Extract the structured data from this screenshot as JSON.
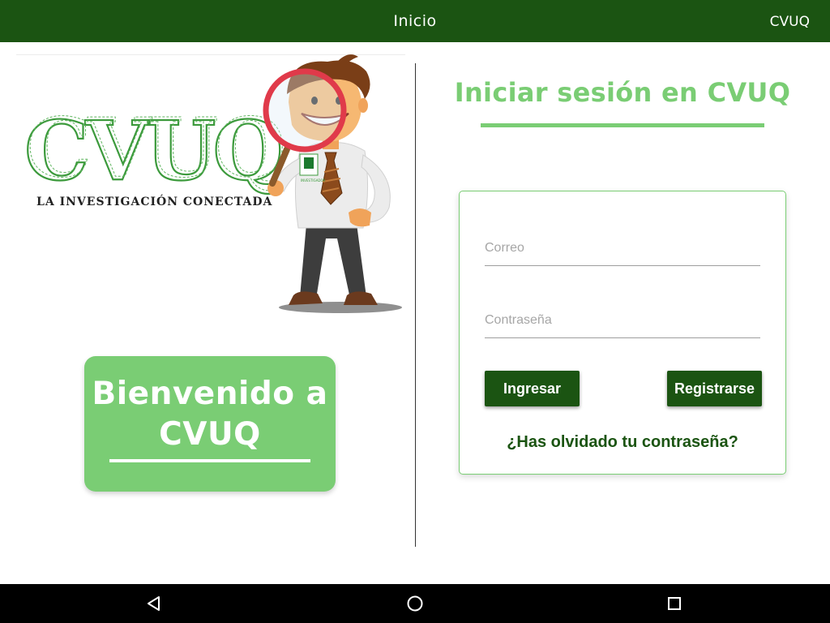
{
  "app_bar": {
    "title": "Inicio",
    "action_label": "CVUQ",
    "color": "#1b5412"
  },
  "logo": {
    "wordmark": "CVUQ",
    "tagline": "LA INVESTIGACIÓN CONECTADA",
    "badge_text": "INVESTIGADOR"
  },
  "welcome": {
    "line1": "Bienvenido a",
    "line2": "CVUQ",
    "background_color": "#7acd74"
  },
  "login": {
    "title": "Iniciar sesión en CVUQ",
    "email": {
      "value": "",
      "placeholder": "Correo"
    },
    "password": {
      "value": "",
      "placeholder": "Contraseña"
    },
    "login_button_label": "Ingresar",
    "register_button_label": "Registrarse",
    "forgot_password_label": "¿Has olvidado tu contraseña?",
    "accent_color": "#7acd74"
  },
  "nav_bar": {
    "back_icon": "back-triangle-icon",
    "home_icon": "home-circle-icon",
    "recents_icon": "recents-square-icon"
  }
}
